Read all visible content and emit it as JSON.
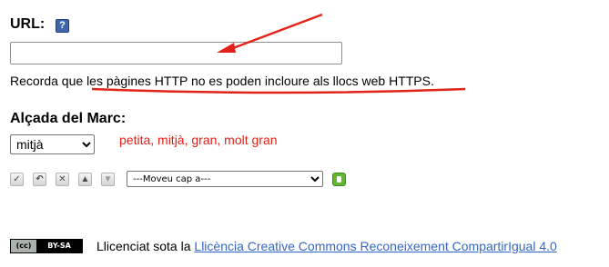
{
  "url_field": {
    "label": "URL:",
    "help_icon": "help-icon",
    "value": "",
    "placeholder": ""
  },
  "note": {
    "prefix": "Recorda que ",
    "emphasis": "les pàgines HTTP no es poden incloure als llocs web HTTPS",
    "suffix": "."
  },
  "frame_height": {
    "label": "Alçada del Marc:",
    "selected": "mitjà",
    "hint": "petita, mitjà, gran, molt gran"
  },
  "toolbar": {
    "icons": [
      "check-icon",
      "undo-icon",
      "delete-icon",
      "move-up-icon",
      "move-down-icon"
    ],
    "move_select_selected": "---Moveu cap a---",
    "go_icon": "go-icon"
  },
  "footer": {
    "badge": {
      "cc_text": "(cc)",
      "by_sa_text": "BY-SA"
    },
    "license_prefix": "Llicenciat sota la ",
    "license_link": "Llicència Creative Commons Reconeixement CompartirIgual 4.0"
  },
  "colors": {
    "annotation_red": "#e2231a",
    "link_blue": "#3366cc",
    "go_green": "#62b62f"
  }
}
